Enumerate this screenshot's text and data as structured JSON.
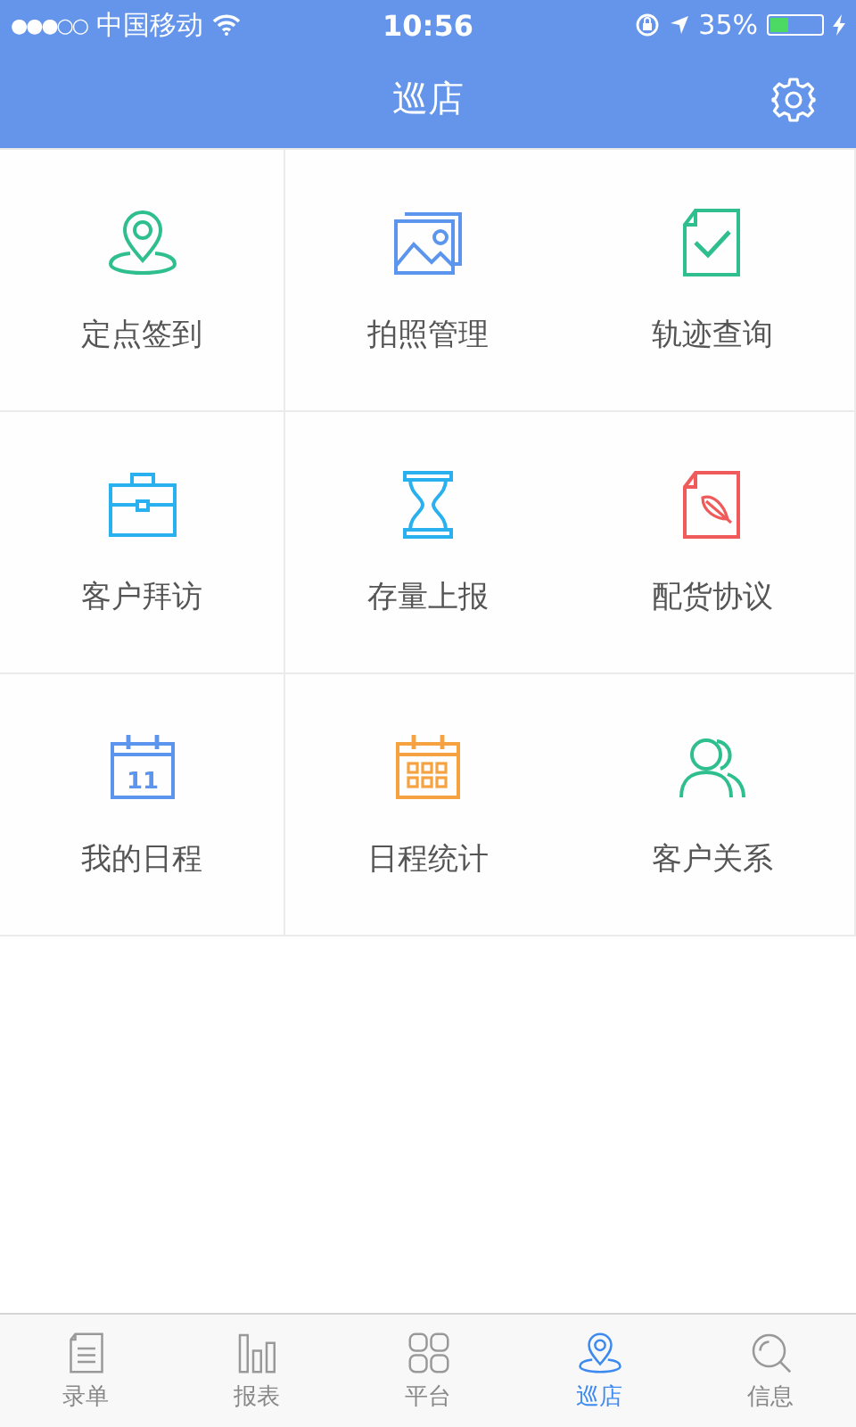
{
  "status_bar": {
    "signal_bars": "●●●○○",
    "carrier": "中国移动",
    "time": "10:56",
    "battery_text": "35%",
    "battery": {
      "level": 0.35
    },
    "charging": true
  },
  "nav_bar": {
    "title": "巡店"
  },
  "tiles": [
    {
      "label": "定点签到",
      "kind": "pin",
      "color": "#2fbf8f"
    },
    {
      "label": "拍照管理",
      "kind": "photos",
      "color": "#5b95ee"
    },
    {
      "label": "轨迹查询",
      "kind": "doc-check",
      "color": "#2fbf8f"
    },
    {
      "label": "客户拜访",
      "kind": "briefcase",
      "color": "#29b0ee"
    },
    {
      "label": "存量上报",
      "kind": "hourglass",
      "color": "#29b0ee"
    },
    {
      "label": "配货协议",
      "kind": "doc-feather",
      "color": "#f05a5a"
    },
    {
      "label": "我的日程",
      "kind": "calendar-day",
      "color": "#5b95ee",
      "icon_text": "11"
    },
    {
      "label": "日程统计",
      "kind": "calendar-grid",
      "color": "#f7a240"
    },
    {
      "label": "客户关系",
      "kind": "people",
      "color": "#2fbf8f"
    }
  ],
  "tab_bar": [
    {
      "label": "录单",
      "kind": "doc",
      "selected": false
    },
    {
      "label": "报表",
      "kind": "bars",
      "selected": false
    },
    {
      "label": "平台",
      "kind": "grid",
      "selected": false
    },
    {
      "label": "巡店",
      "kind": "pin",
      "selected": true
    },
    {
      "label": "信息",
      "kind": "search",
      "selected": false
    }
  ]
}
